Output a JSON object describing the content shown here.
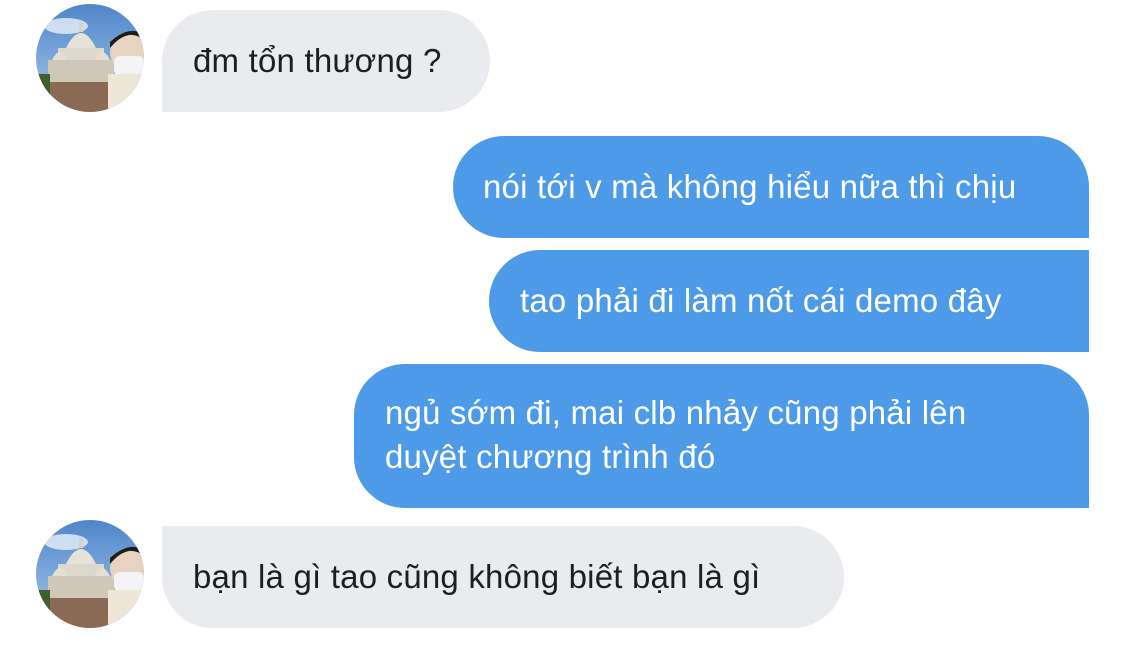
{
  "conversation": {
    "colors": {
      "incoming_bubble": "#e9ebee",
      "outgoing_bubble": "#4d9be8",
      "incoming_text": "#1c1e21",
      "outgoing_text": "#ffffff"
    },
    "messages": [
      {
        "direction": "incoming",
        "text": "đm tổn thương ?",
        "avatar": "contact-avatar-photo"
      },
      {
        "direction": "outgoing",
        "text": "nói tới v mà không hiểu nữa thì chịu"
      },
      {
        "direction": "outgoing",
        "text": "tao phải đi làm nốt cái demo đây"
      },
      {
        "direction": "outgoing",
        "lines": [
          "ngủ sớm đi, mai clb nhảy cũng phải lên",
          "duyệt chương trình đó"
        ]
      },
      {
        "direction": "incoming",
        "text": "bạn là gì tao cũng không biết bạn là gì",
        "avatar": "contact-avatar-photo"
      }
    ]
  }
}
